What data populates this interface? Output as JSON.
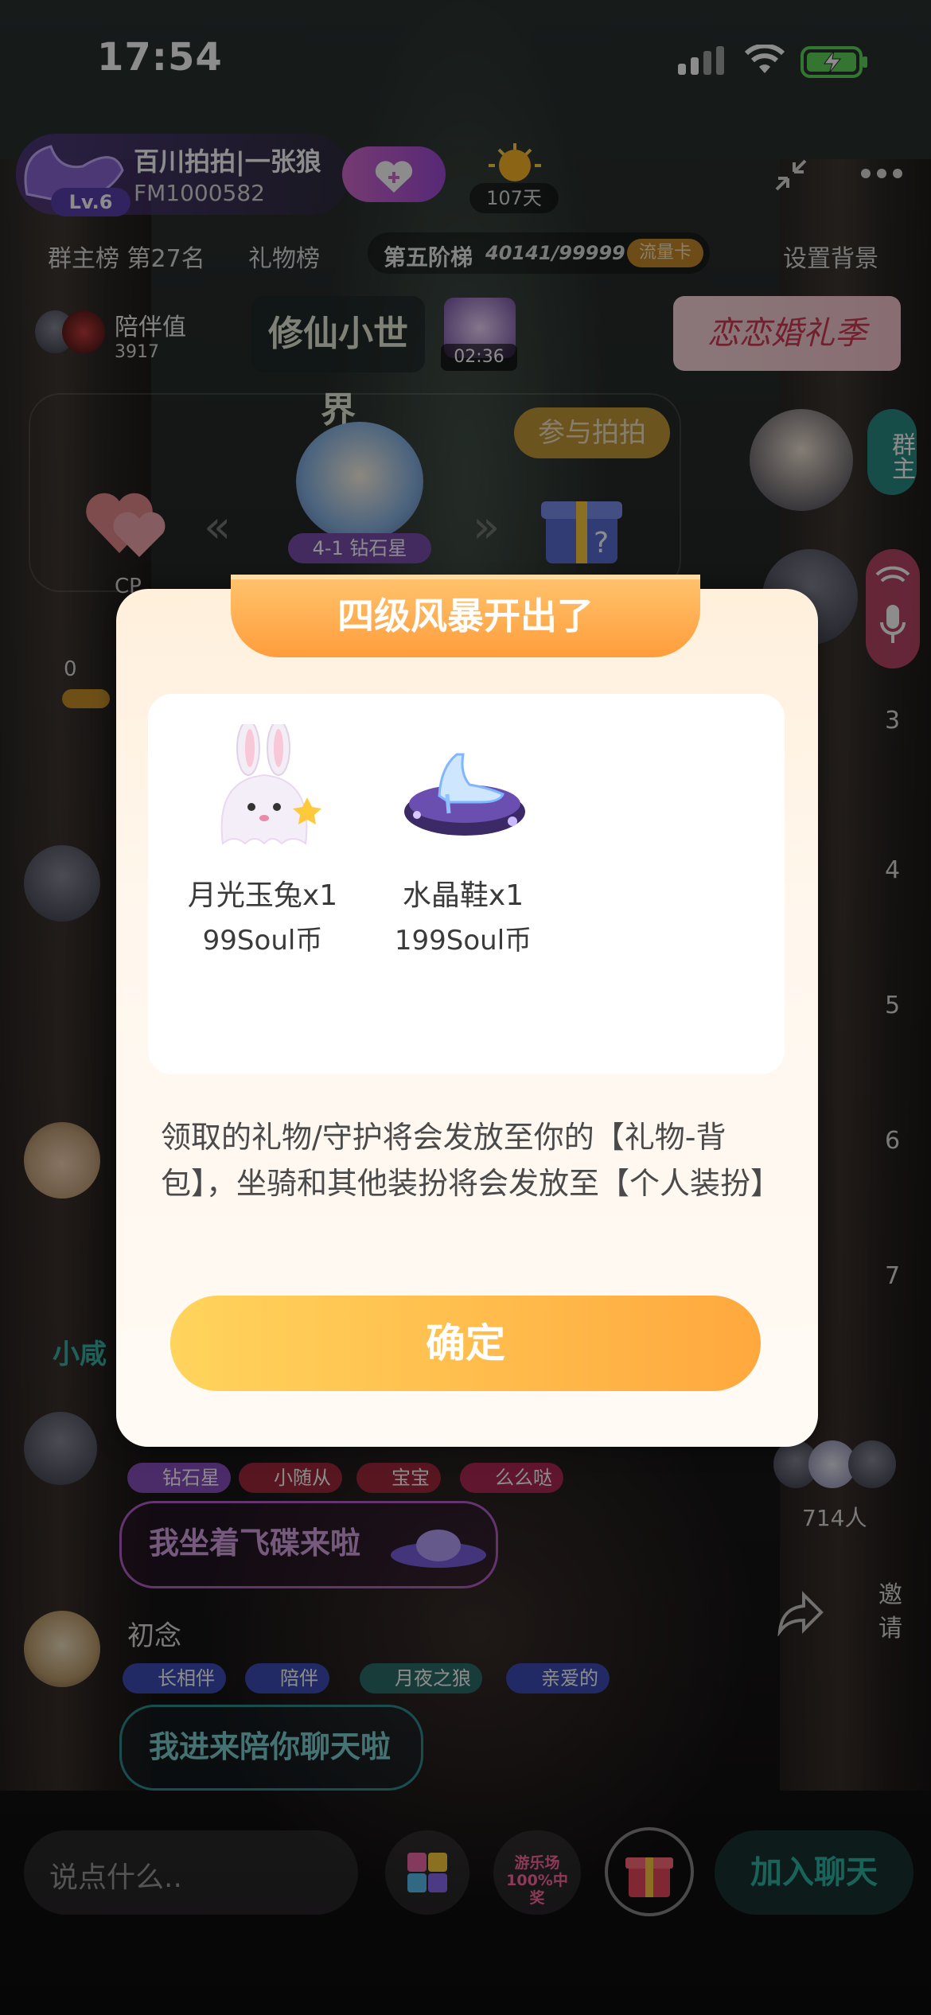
{
  "status_bar": {
    "time": "17:54"
  },
  "room": {
    "name": "百川拍拍|一张狼",
    "id": "FM1000582",
    "level": "Lv.6",
    "days": "107天",
    "host_rank": "群主榜 第27名",
    "gift_rank": "礼物榜",
    "ladder_label": "第五阶梯",
    "ladder_progress": "40141/99999",
    "traffic_card": "流量卡",
    "set_background": "设置背景",
    "companion_label": "陪伴值",
    "companion_value": "3917",
    "game_banner": "修仙小世界",
    "timer": "02:36",
    "wedding_banner": "恋恋婚礼季",
    "join_pat": "参与拍拍",
    "star_label": "4-1 钻石星",
    "cp_label": "CP",
    "zero": "0",
    "host_side_label": "群主",
    "online_count": "714人",
    "invite_label": "邀请",
    "side_seats": [
      "3",
      "4",
      "5",
      "6",
      "7"
    ]
  },
  "chat": {
    "user2_tags": [
      "钻石星",
      "小随从",
      "宝宝",
      "么么哒"
    ],
    "message_ufo": "我坐着飞碟来啦",
    "user3_name": "初念",
    "user3_tags": [
      "长相伴",
      "陪伴",
      "月夜之狼",
      "亲爱的"
    ],
    "message_join": "我进来陪你聊天啦",
    "partial_name": "小咸"
  },
  "bottom_bar": {
    "input_placeholder": "说点什么..",
    "game_badge": "游乐场 100%中奖",
    "join_chat": "加入聊天"
  },
  "modal": {
    "title": "四级风暴开出了",
    "prizes": [
      {
        "name": "月光玉兔x1",
        "price": "99Soul币"
      },
      {
        "name": "水晶鞋x1",
        "price": "199Soul币"
      }
    ],
    "notice": "领取的礼物/守护将会发放至你的【礼物-背包】，坐骑和其他装扮将会发放至【个人装扮】",
    "confirm_label": "确定"
  },
  "colors": {
    "modal_orange": "#ff9d3c",
    "button_start": "#ffd45c",
    "button_end": "#ffa83e"
  }
}
